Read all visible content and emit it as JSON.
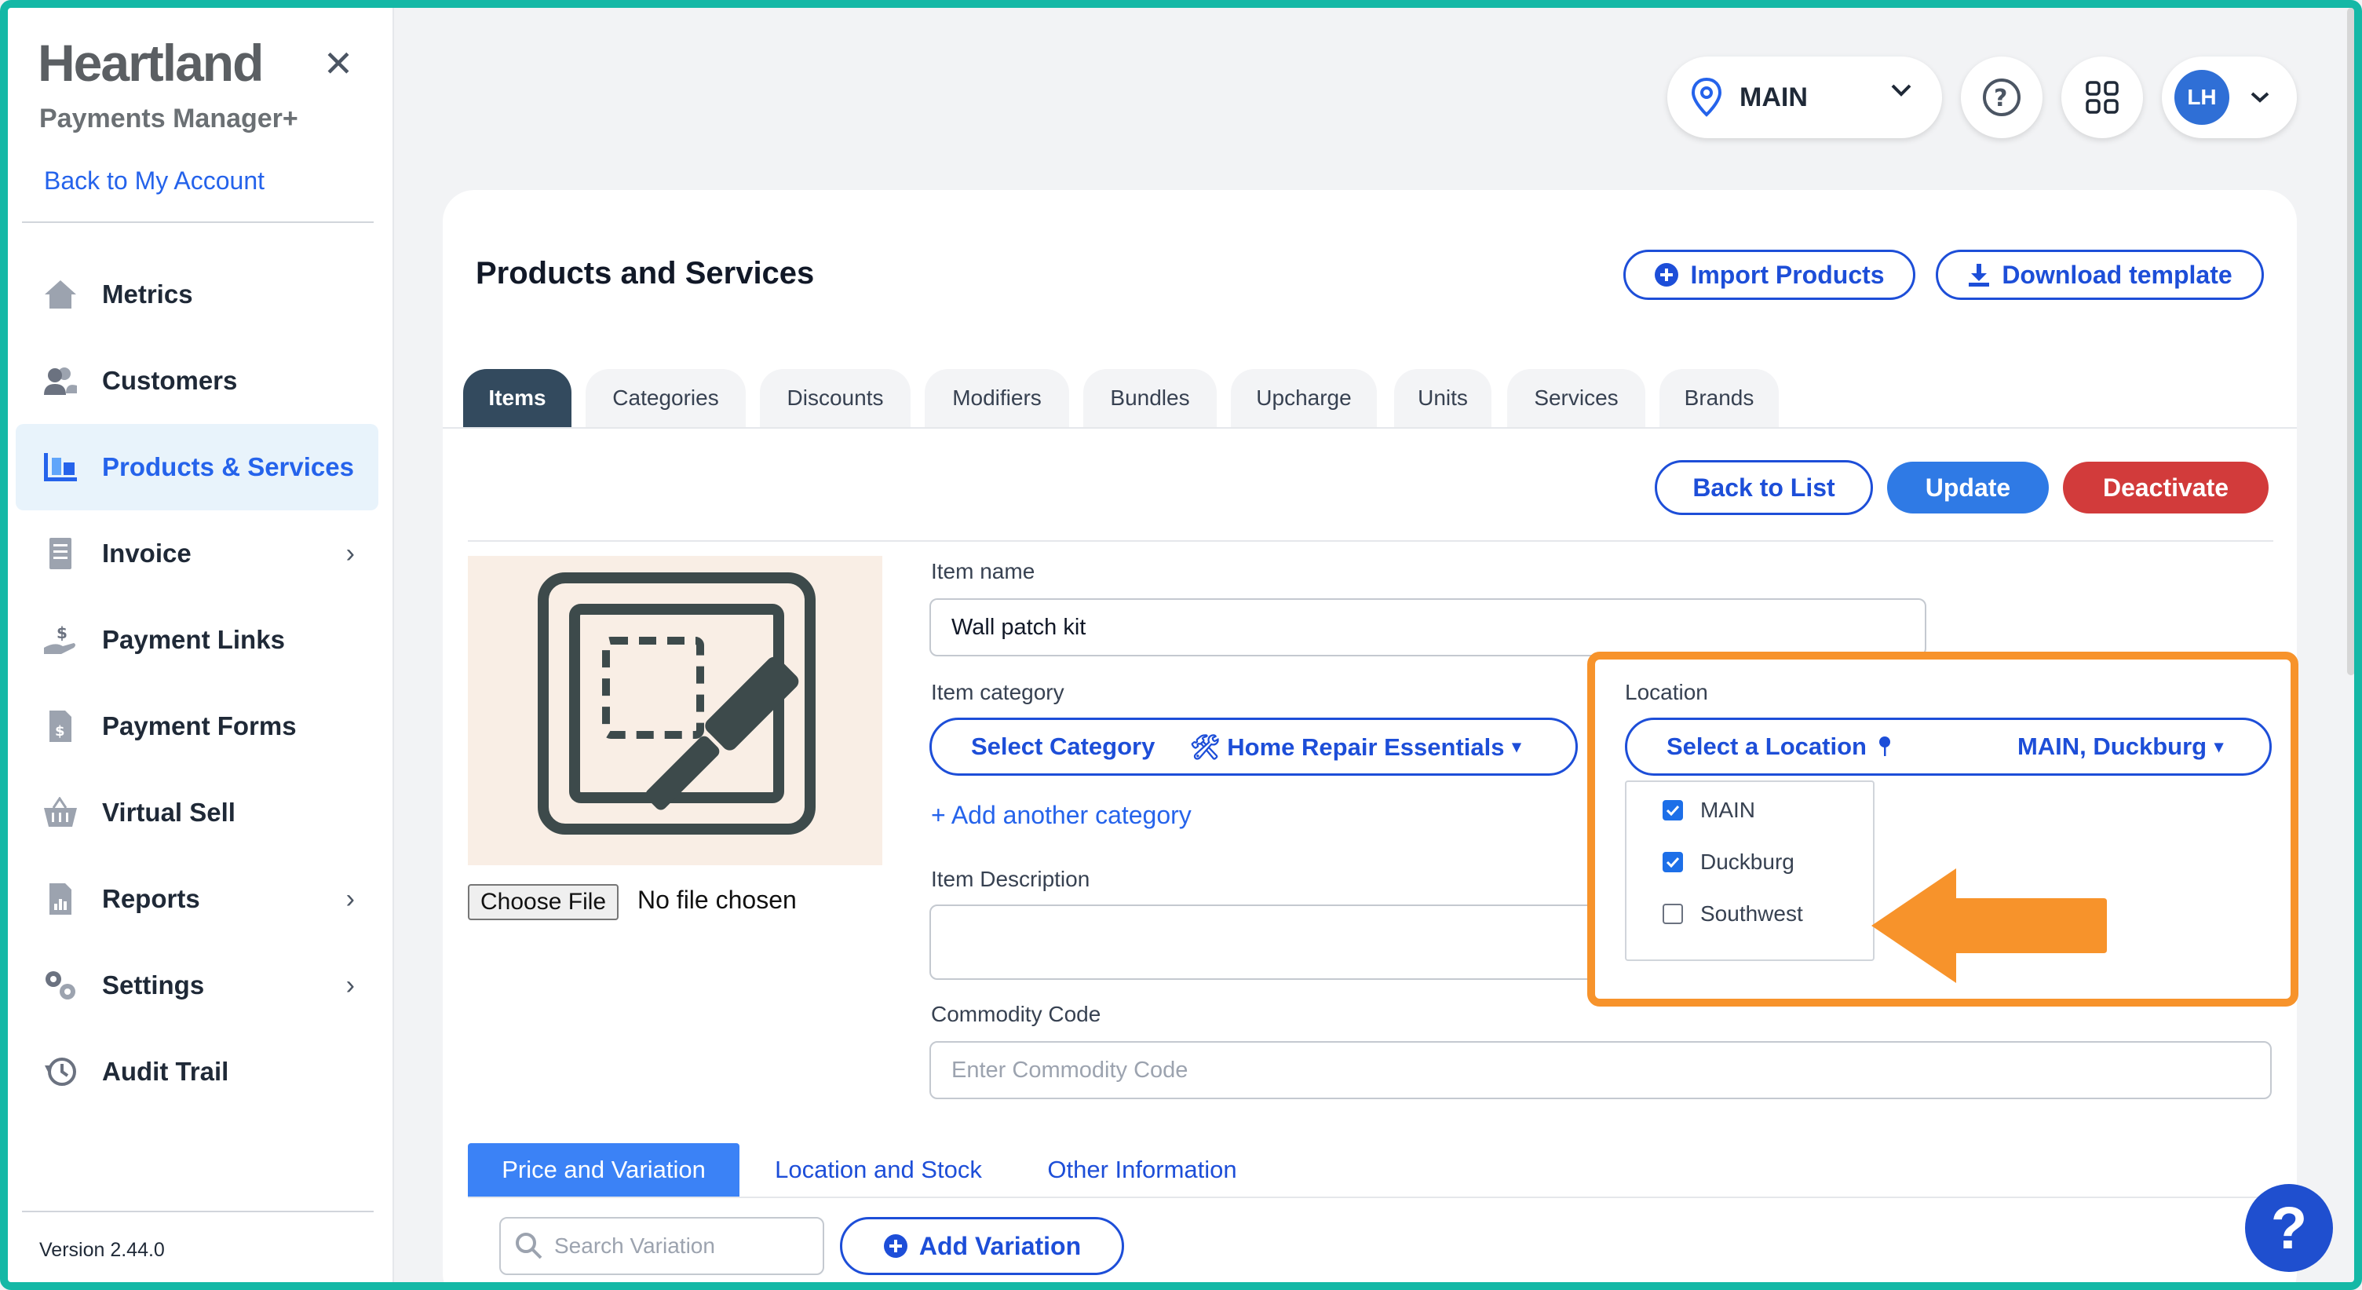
{
  "sidebar": {
    "brand_title": "Heartland",
    "brand_subtitle": "Payments Manager+",
    "back_link": "Back to My Account",
    "items": [
      {
        "label": "Metrics",
        "icon": "home-icon"
      },
      {
        "label": "Customers",
        "icon": "users-icon"
      },
      {
        "label": "Products & Services",
        "icon": "products-icon",
        "active": true
      },
      {
        "label": "Invoice",
        "icon": "invoice-icon",
        "has_children": true
      },
      {
        "label": "Payment Links",
        "icon": "payment-link-icon"
      },
      {
        "label": "Payment Forms",
        "icon": "payment-form-icon"
      },
      {
        "label": "Virtual Sell",
        "icon": "basket-icon"
      },
      {
        "label": "Reports",
        "icon": "reports-icon",
        "has_children": true
      },
      {
        "label": "Settings",
        "icon": "gears-icon",
        "has_children": true
      },
      {
        "label": "Audit Trail",
        "icon": "history-icon"
      }
    ],
    "version": "Version 2.44.0"
  },
  "topbar": {
    "location_label": "MAIN",
    "avatar_initials": "LH"
  },
  "page": {
    "title": "Products and Services",
    "import_button": "Import Products",
    "download_button": "Download template",
    "tabs": [
      "Items",
      "Categories",
      "Discounts",
      "Modifiers",
      "Bundles",
      "Upcharge",
      "Units",
      "Services",
      "Brands"
    ],
    "active_tab": "Items",
    "back_to_list": "Back to List",
    "update": "Update",
    "deactivate": "Deactivate"
  },
  "form": {
    "choose_file": "Choose File",
    "no_file": "No file chosen",
    "item_name_label": "Item name",
    "item_name_value": "Wall patch kit",
    "item_category_label": "Item category",
    "select_category": "Select Category",
    "category_value": "🛠 Home Repair Essentials",
    "add_category": "+ Add another category",
    "item_description_label": "Item Description",
    "commodity_code_label": "Commodity Code",
    "commodity_code_placeholder": "Enter Commodity Code",
    "location_label": "Location",
    "select_location": "Select a Location",
    "location_value": "MAIN, Duckburg",
    "location_options": [
      {
        "label": "MAIN",
        "checked": true
      },
      {
        "label": "Duckburg",
        "checked": true
      },
      {
        "label": "Southwest",
        "checked": false
      }
    ]
  },
  "subtabs": [
    "Price and Variation",
    "Location and Stock",
    "Other Information"
  ],
  "variation": {
    "search_placeholder": "Search Variation",
    "add_variation": "Add Variation"
  },
  "colors": {
    "brand_blue": "#1d4ed8",
    "update_blue": "#2f7ae5",
    "deactivate_red": "#d23b3b",
    "highlight_orange": "#f7932b",
    "frame_teal": "#14b8a6"
  }
}
